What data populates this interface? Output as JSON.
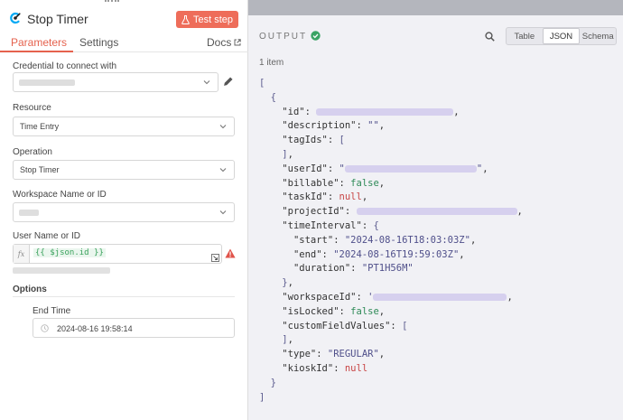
{
  "node": {
    "title": "Stop Timer",
    "test_button_label": "Test step"
  },
  "tabs": {
    "parameters": "Parameters",
    "settings": "Settings",
    "docs": "Docs"
  },
  "fields": {
    "credential_label": "Credential to connect with",
    "resource_label": "Resource",
    "resource_value": "Time Entry",
    "operation_label": "Operation",
    "operation_value": "Stop Timer",
    "workspace_label": "Workspace Name or ID",
    "user_label": "User Name or ID",
    "fx_label": "fx",
    "user_expression": "{{ $json.id }}",
    "options_title": "Options",
    "end_time_label": "End Time",
    "end_time_value": "2024-08-16 19:58:14"
  },
  "output": {
    "title": "OUTPUT",
    "view_modes": [
      "Table",
      "JSON",
      "Schema"
    ],
    "active_view": "JSON",
    "item_count": "1 item"
  },
  "json_view": {
    "open_array": "[",
    "open_obj": "{",
    "close_obj": "}",
    "close_array": "]",
    "k_id": "\"id\"",
    "k_description": "\"description\"",
    "v_description": "\"\"",
    "k_tagIds": "\"tagIds\"",
    "k_userId": "\"userId\"",
    "k_billable": "\"billable\"",
    "v_billable": "false",
    "k_taskId": "\"taskId\"",
    "v_taskId": "null",
    "k_projectId": "\"projectId\"",
    "k_timeInterval": "\"timeInterval\"",
    "k_start": "\"start\"",
    "v_start": "\"2024-08-16T18:03:03Z\"",
    "k_end": "\"end\"",
    "v_end": "\"2024-08-16T19:59:03Z\"",
    "k_duration": "\"duration\"",
    "v_duration": "\"PT1H56M\"",
    "k_workspaceId": "\"workspaceId\"",
    "k_isLocked": "\"isLocked\"",
    "v_isLocked": "false",
    "k_customFieldValues": "\"customFieldValues\"",
    "k_type": "\"type\"",
    "v_type": "\"REGULAR\"",
    "k_kioskId": "\"kioskId\"",
    "v_kioskId": "null"
  },
  "colors": {
    "accent": "#ee6d5a",
    "success": "#3aa364",
    "warning": "#e0534a"
  }
}
